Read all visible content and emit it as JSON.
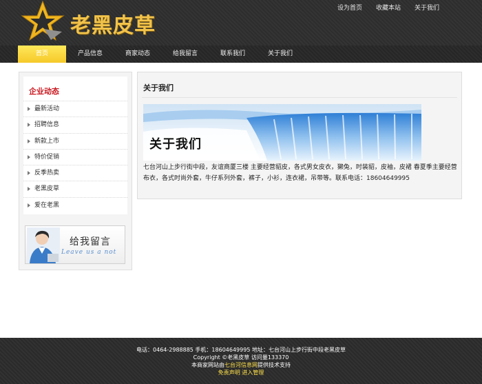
{
  "header": {
    "site_title": "老黑皮草",
    "top_links": [
      "设为首页",
      "收藏本站",
      "关于我们"
    ]
  },
  "nav": {
    "items": [
      "首页",
      "产品信息",
      "商家动态",
      "给我留言",
      "联系我们",
      "关于我们"
    ],
    "active_index": 0
  },
  "sidebar": {
    "title": "企业动态",
    "items": [
      "最新活动",
      "招聘信息",
      "新款上市",
      "特价促销",
      "反季热卖",
      "老黑皮草",
      "爱在老黑"
    ],
    "banner": {
      "title": "给我留言",
      "subtitle": "Leave us a not"
    }
  },
  "main": {
    "title": "关于我们",
    "banner_text": "关于我们",
    "body": "七台河山上步行街中段，友谊商厦三楼  主要经营貂皮，各式男女皮衣，獭兔，时装貂，皮袖，皮裙 春夏季主要经营布衣，各式时尚外套，牛仔系列外套，裤子，小衫，连衣裙，吊带等。联系电话：18604649995"
  },
  "footer": {
    "line1": "电话：0464-2988885 手机：18604649995 地址：七台河山上步行街中段老黑皮草",
    "line2": "Copyright ©老黑皮草 访问量133370",
    "line3_prefix": "本商家网站由",
    "line3_link": "七台河信息网",
    "line3_suffix": "提供技术支持",
    "disclaimer": "免责声明",
    "admin": "进入管理"
  },
  "colors": {
    "accent": "#f5c92a",
    "sidebar_title": "#c8171e",
    "header_bg": "#2d2d2d"
  }
}
